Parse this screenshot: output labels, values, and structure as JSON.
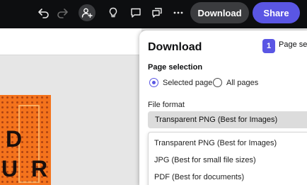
{
  "toolbar": {
    "download_label": "Download",
    "share_label": "Share",
    "icons": [
      "undo-icon",
      "redo-icon",
      "add-person-icon",
      "lightbulb-icon",
      "comment-icon",
      "comments-icon",
      "more-icon"
    ]
  },
  "artwork": {
    "glyphs": [
      "D",
      "U",
      "R"
    ]
  },
  "download_panel": {
    "title": "Download",
    "step_number": "1",
    "step_label": "Page sele",
    "page_selection_label": "Page selection",
    "selected_page_label": "Selected page",
    "all_pages_label": "All pages",
    "selected_option": "Selected page",
    "file_format_label": "File format",
    "file_format_value": "Transparent PNG (Best for Images)",
    "file_format_options": [
      "Transparent PNG (Best for Images)",
      "JPG (Best for small file sizes)",
      "PDF (Best for documents)"
    ]
  },
  "colors": {
    "accent": "#5a56e4",
    "toolbar_bg": "#0d0e10",
    "artwork": "#f4731c"
  }
}
